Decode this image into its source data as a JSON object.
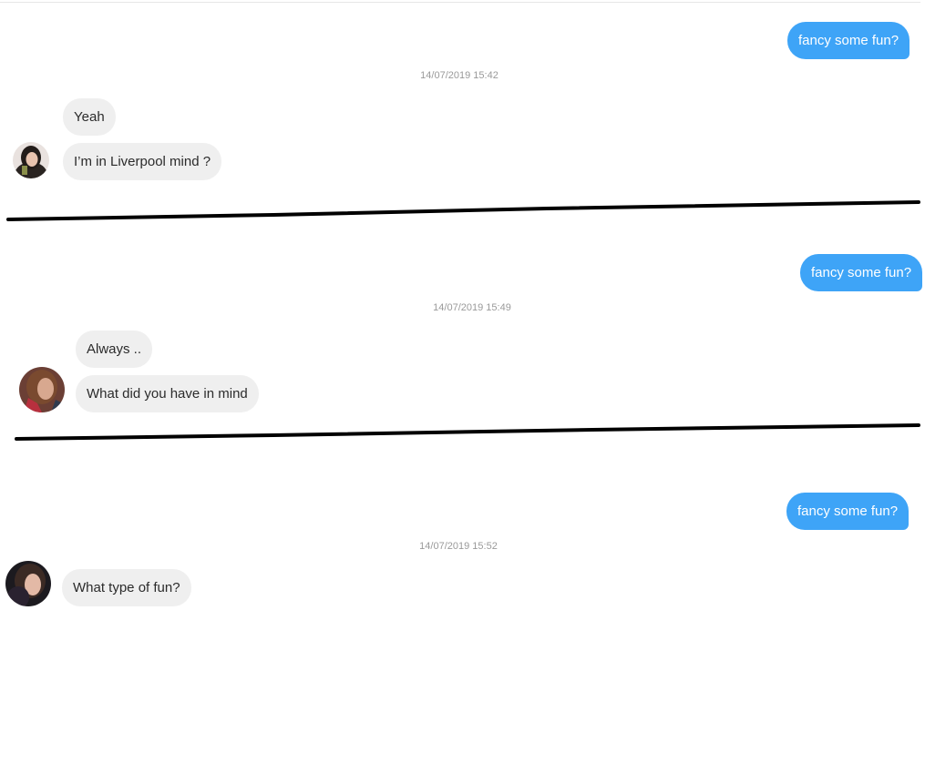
{
  "conversations": [
    {
      "outgoing": "fancy some fun?",
      "timestamp": "14/07/2019 15:42",
      "incoming": [
        "Yeah",
        "I’m in Liverpool mind ?"
      ]
    },
    {
      "outgoing": "fancy some fun?",
      "timestamp": "14/07/2019 15:49",
      "incoming": [
        "Always ..",
        "What did you have in mind"
      ]
    },
    {
      "outgoing": "fancy some fun?",
      "timestamp": "14/07/2019 15:52",
      "incoming": [
        "What type of fun?"
      ]
    }
  ],
  "colors": {
    "outgoing_bubble": "#3ea4f7",
    "incoming_bubble": "#efefef",
    "timestamp_text": "#9a9a9a",
    "divider": "#000000"
  },
  "icons": {
    "avatar": "profile-photo-avatar"
  }
}
